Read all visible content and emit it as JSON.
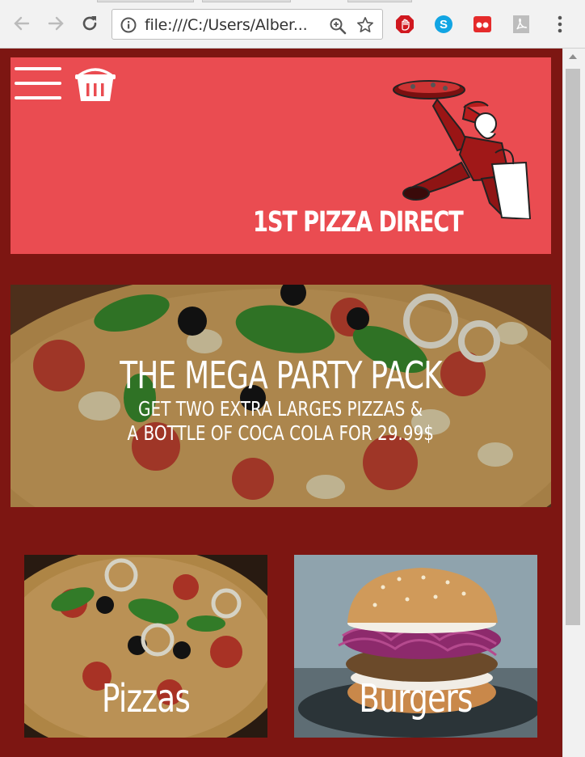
{
  "browser": {
    "url": "file:///C:/Users/Alber...",
    "extensions": [
      "adblock-icon",
      "skype-icon",
      "tab-icon",
      "pdf-icon"
    ]
  },
  "site": {
    "brand": "1ST PIZZA DIRECT",
    "promo": {
      "headline": "THE MEGA PARTY PACK",
      "sub_line_1": "GET TWO EXTRA LARGES PIZZAS &",
      "sub_line_2": "A BOTTLE OF COCA COLA FOR 29.99$"
    },
    "categories": [
      {
        "label": "Pizzas"
      },
      {
        "label": "Burgers"
      }
    ]
  },
  "colors": {
    "page_bg": "#7d1612",
    "hero_bg": "#ea4c51",
    "text": "#ffffff"
  }
}
